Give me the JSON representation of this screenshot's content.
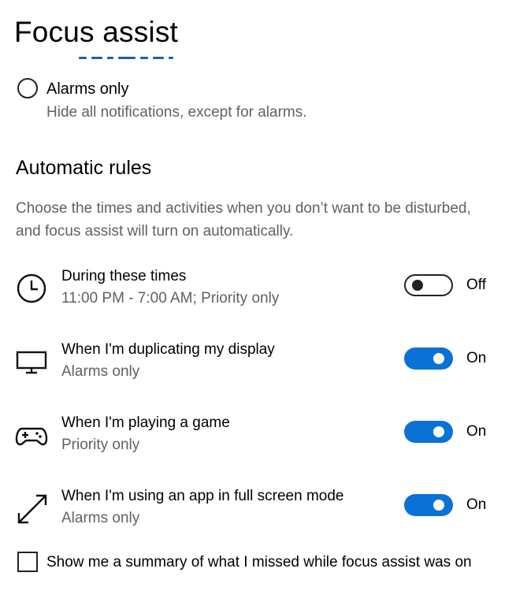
{
  "page": {
    "title": "Focus assist"
  },
  "alarms_option": {
    "label": "Alarms only",
    "description": "Hide all notifications, except for alarms.",
    "selected": false
  },
  "automatic_rules": {
    "title": "Automatic rules",
    "description": "Choose the times and activities when you don’t want to be disturbed, and focus assist will turn on automatically.",
    "rules": [
      {
        "icon": "clock-icon",
        "title": "During these times",
        "subtitle": "11:00 PM - 7:00 AM; Priority only",
        "on": false,
        "state_label": "Off"
      },
      {
        "icon": "monitor-icon",
        "title": "When I'm duplicating my display",
        "subtitle": "Alarms only",
        "on": true,
        "state_label": "On"
      },
      {
        "icon": "gamepad-icon",
        "title": "When I'm playing a game",
        "subtitle": "Priority only",
        "on": true,
        "state_label": "On"
      },
      {
        "icon": "fullscreen-arrow-icon",
        "title": "When I'm using an app in full screen mode",
        "subtitle": "Alarms only",
        "on": true,
        "state_label": "On"
      }
    ]
  },
  "summary_checkbox": {
    "label": "Show me a summary of what I missed while focus assist was on",
    "checked": false
  },
  "colors": {
    "accent": "#0a72d6",
    "secondary_text": "#616161"
  }
}
